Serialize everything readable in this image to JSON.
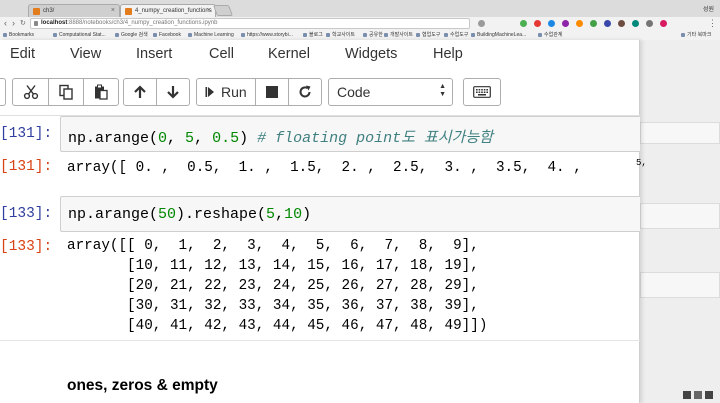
{
  "browser": {
    "tabs": [
      {
        "label": "ch3/"
      },
      {
        "label": "4_numpy_creation_functions"
      }
    ],
    "address": {
      "host": "localhost",
      "path": ":8888/notebooks/ch3/4_numpy_creation_functions.ipynb"
    },
    "profile_label": "성원",
    "bookmarks": [
      "Bookmarks",
      "Computational Stat...",
      "Google 검색",
      "Facebook",
      "Machine Learning",
      "https://www.storybi...",
      "블로그",
      "학교사이트",
      "공유한",
      "개발사이트",
      "협업도구",
      "수업도구",
      "BuildingMachineLea...",
      "수업관계"
    ],
    "other_bookmarks": "기타 북마크"
  },
  "menu": {
    "items": [
      "Edit",
      "View",
      "Insert",
      "Cell",
      "Kernel",
      "Widgets",
      "Help"
    ]
  },
  "toolbar": {
    "run_label": "Run",
    "cell_type": "Code",
    "icons": [
      "scissors-icon",
      "copy-icon",
      "paste-icon",
      "arrow-up-icon",
      "arrow-down-icon",
      "run-icon",
      "stop-icon",
      "restart-icon",
      "keyboard-icon"
    ]
  },
  "cells": [
    {
      "in_prompt": "[131]:",
      "code": {
        "fn": "np.arange(",
        "a1": "0",
        "sep1": ", ",
        "a2": "5",
        "sep2": ", ",
        "a3": "0.5",
        "close": ") ",
        "comment": "# floating point도 표시가능함"
      },
      "out_prompt": "[131]:",
      "output": "array([ 0. ,  0.5,  1. ,  1.5,  2. ,  2.5,  3. ,  3.5,  4. ,",
      "overflow_char": "5,"
    },
    {
      "in_prompt": "[133]:",
      "code": {
        "fn": "np.arange(",
        "a1": "50",
        "mid": ").reshape(",
        "a2": "5",
        "sep": ",",
        "a3": "10",
        "close": ")"
      },
      "out_prompt": "[133]:",
      "output_lines": [
        "array([[ 0,  1,  2,  3,  4,  5,  6,  7,  8,  9],",
        "       [10, 11, 12, 13, 14, 15, 16, 17, 18, 19],",
        "       [20, 21, 22, 23, 24, 25, 26, 27, 28, 29],",
        "       [30, 31, 32, 33, 34, 35, 36, 37, 38, 39],",
        "       [40, 41, 42, 43, 44, 45, 46, 47, 48, 49]])"
      ]
    }
  ],
  "markdown": {
    "heading": "ones, zeros & empty"
  }
}
